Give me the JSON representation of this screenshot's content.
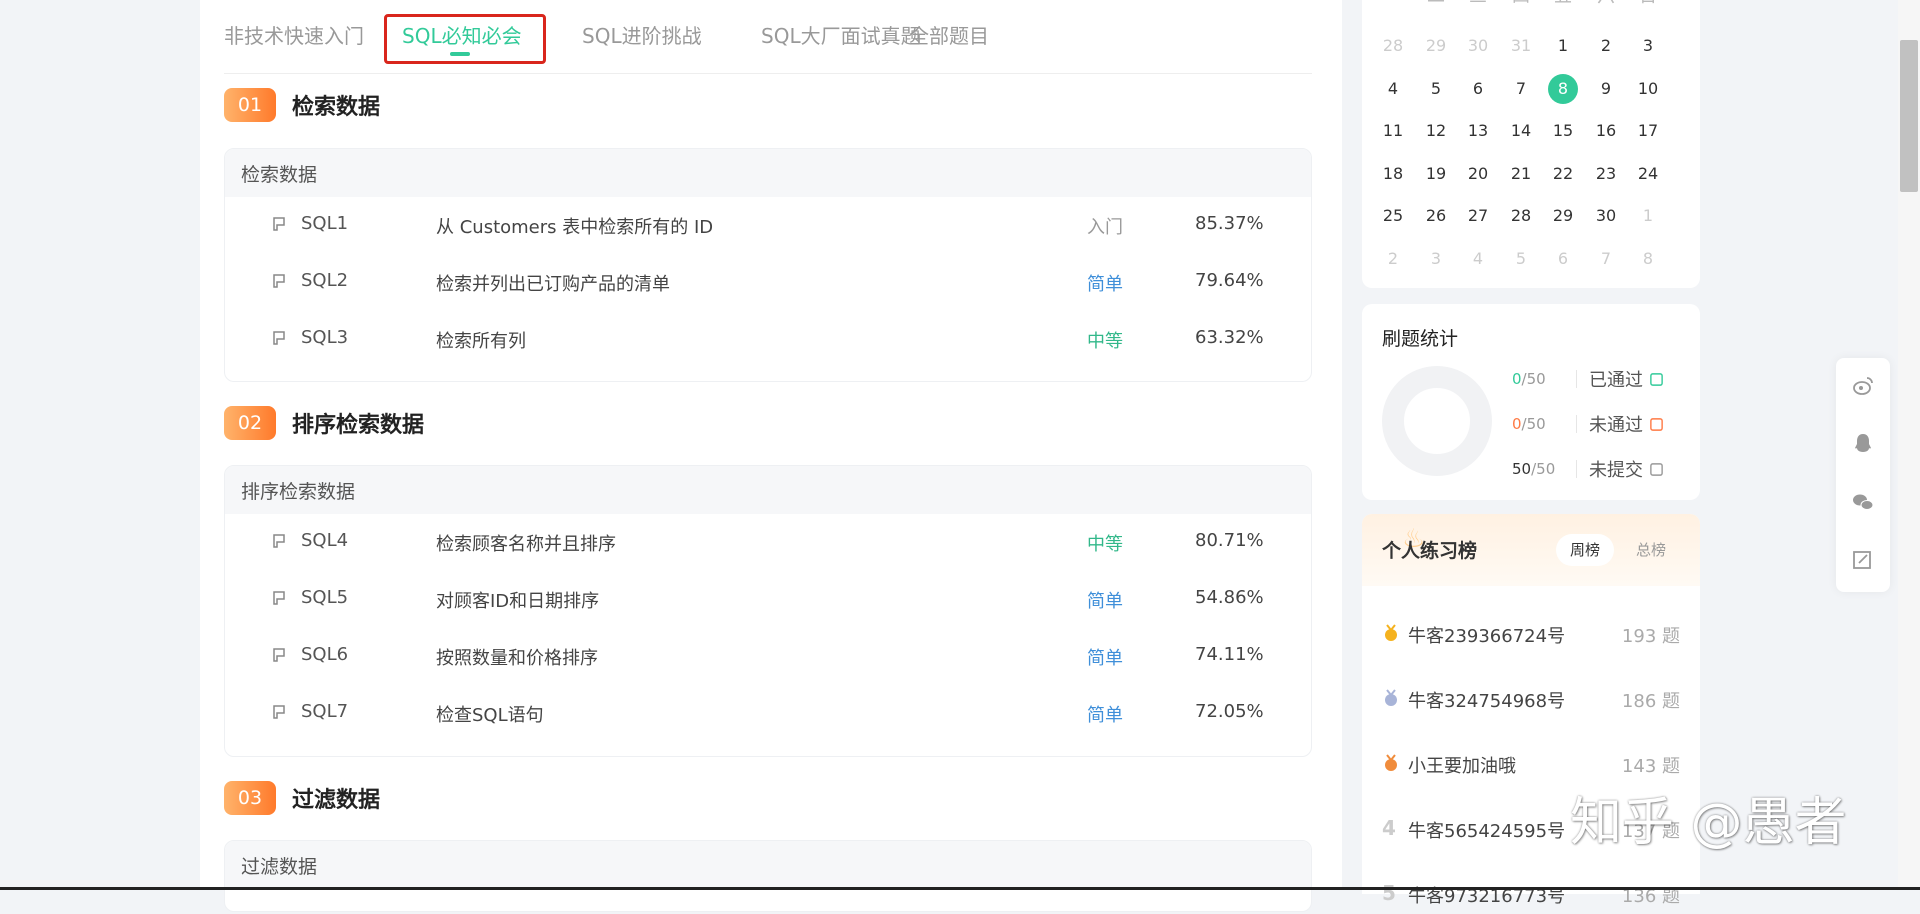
{
  "tabs": [
    {
      "label": "非技术快速入门"
    },
    {
      "label": "SQL必知必会"
    },
    {
      "label": "SQL进阶挑战"
    },
    {
      "label": "SQL大厂面试真题"
    },
    {
      "label": "全部题目"
    }
  ],
  "active_tab": "SQL必知必会",
  "sections": [
    {
      "number": "01",
      "title": "检索数据",
      "card_title": "检索数据",
      "questions": [
        {
          "code": "SQL1",
          "title": "从 Customers 表中检索所有的 ID",
          "difficulty": "入门",
          "pass_rate": "85.37%"
        },
        {
          "code": "SQL2",
          "title": "检索并列出已订购产品的清单",
          "difficulty": "简单",
          "pass_rate": "79.64%"
        },
        {
          "code": "SQL3",
          "title": "检索所有列",
          "difficulty": "中等",
          "pass_rate": "63.32%"
        }
      ]
    },
    {
      "number": "02",
      "title": "排序检索数据",
      "card_title": "排序检索数据",
      "questions": [
        {
          "code": "SQL4",
          "title": "检索顾客名称并且排序",
          "difficulty": "中等",
          "pass_rate": "80.71%"
        },
        {
          "code": "SQL5",
          "title": "对顾客ID和日期排序",
          "difficulty": "简单",
          "pass_rate": "54.86%"
        },
        {
          "code": "SQL6",
          "title": "按照数量和价格排序",
          "difficulty": "简单",
          "pass_rate": "74.11%"
        },
        {
          "code": "SQL7",
          "title": "检查SQL语句",
          "difficulty": "简单",
          "pass_rate": "72.05%"
        }
      ]
    },
    {
      "number": "03",
      "title": "过滤数据",
      "card_title": "过滤数据",
      "questions": []
    }
  ],
  "difficulty_colors": {
    "入门": "#999999",
    "简单": "#3f8fd9",
    "中等": "#32b88a"
  },
  "calendar": {
    "weekdays": [
      "一",
      "二",
      "三",
      "四",
      "五",
      "六",
      "日"
    ],
    "weeks": [
      [
        {
          "d": "28",
          "m": true
        },
        {
          "d": "29",
          "m": true
        },
        {
          "d": "30",
          "m": true
        },
        {
          "d": "31",
          "m": true
        },
        {
          "d": "1"
        },
        {
          "d": "2"
        },
        {
          "d": "3"
        }
      ],
      [
        {
          "d": "4"
        },
        {
          "d": "5"
        },
        {
          "d": "6"
        },
        {
          "d": "7"
        },
        {
          "d": "8",
          "today": true
        },
        {
          "d": "9"
        },
        {
          "d": "10"
        }
      ],
      [
        {
          "d": "11"
        },
        {
          "d": "12"
        },
        {
          "d": "13"
        },
        {
          "d": "14"
        },
        {
          "d": "15"
        },
        {
          "d": "16"
        },
        {
          "d": "17"
        }
      ],
      [
        {
          "d": "18"
        },
        {
          "d": "19"
        },
        {
          "d": "20"
        },
        {
          "d": "21"
        },
        {
          "d": "22"
        },
        {
          "d": "23"
        },
        {
          "d": "24"
        }
      ],
      [
        {
          "d": "25"
        },
        {
          "d": "26"
        },
        {
          "d": "27"
        },
        {
          "d": "28"
        },
        {
          "d": "29"
        },
        {
          "d": "30"
        },
        {
          "d": "1",
          "m": true
        }
      ],
      [
        {
          "d": "2",
          "m": true
        },
        {
          "d": "3",
          "m": true
        },
        {
          "d": "4",
          "m": true
        },
        {
          "d": "5",
          "m": true
        },
        {
          "d": "6",
          "m": true
        },
        {
          "d": "7",
          "m": true
        },
        {
          "d": "8",
          "m": true
        }
      ]
    ]
  },
  "stats": {
    "title": "刷题统计",
    "rows": [
      {
        "count": "0",
        "total": "/50",
        "label": "已通过",
        "color": "#32ca99",
        "icon": "passed-icon"
      },
      {
        "count": "0",
        "total": "/50",
        "label": "未通过",
        "color": "#ff7a45",
        "icon": "failed-icon"
      },
      {
        "count": "50",
        "total": "/50",
        "label": "未提交",
        "color": "#333333",
        "icon": "unsubmitted-icon"
      }
    ]
  },
  "ranking": {
    "title": "个人练习榜",
    "tab_weekly": "周榜",
    "tab_total": "总榜",
    "entries": [
      {
        "name": "牛客239366724号",
        "score": "193 题",
        "rank": "1"
      },
      {
        "name": "牛客324754968号",
        "score": "186 题",
        "rank": "2"
      },
      {
        "name": "小王要加油哦",
        "score": "143 题",
        "rank": "3"
      },
      {
        "name": "牛客565424595号",
        "score": "137 题",
        "rank": "4"
      },
      {
        "name": "牛客973216773号",
        "score": "136 题",
        "rank": "5"
      }
    ]
  },
  "float_bar": [
    "weibo-icon",
    "qq-icon",
    "wechat-icon",
    "feedback-icon"
  ],
  "watermark": "知乎 @愚者",
  "colors": {
    "accent": "#32ca99",
    "highlight_box": "#d9261c",
    "badge": "#ff8a3d"
  }
}
